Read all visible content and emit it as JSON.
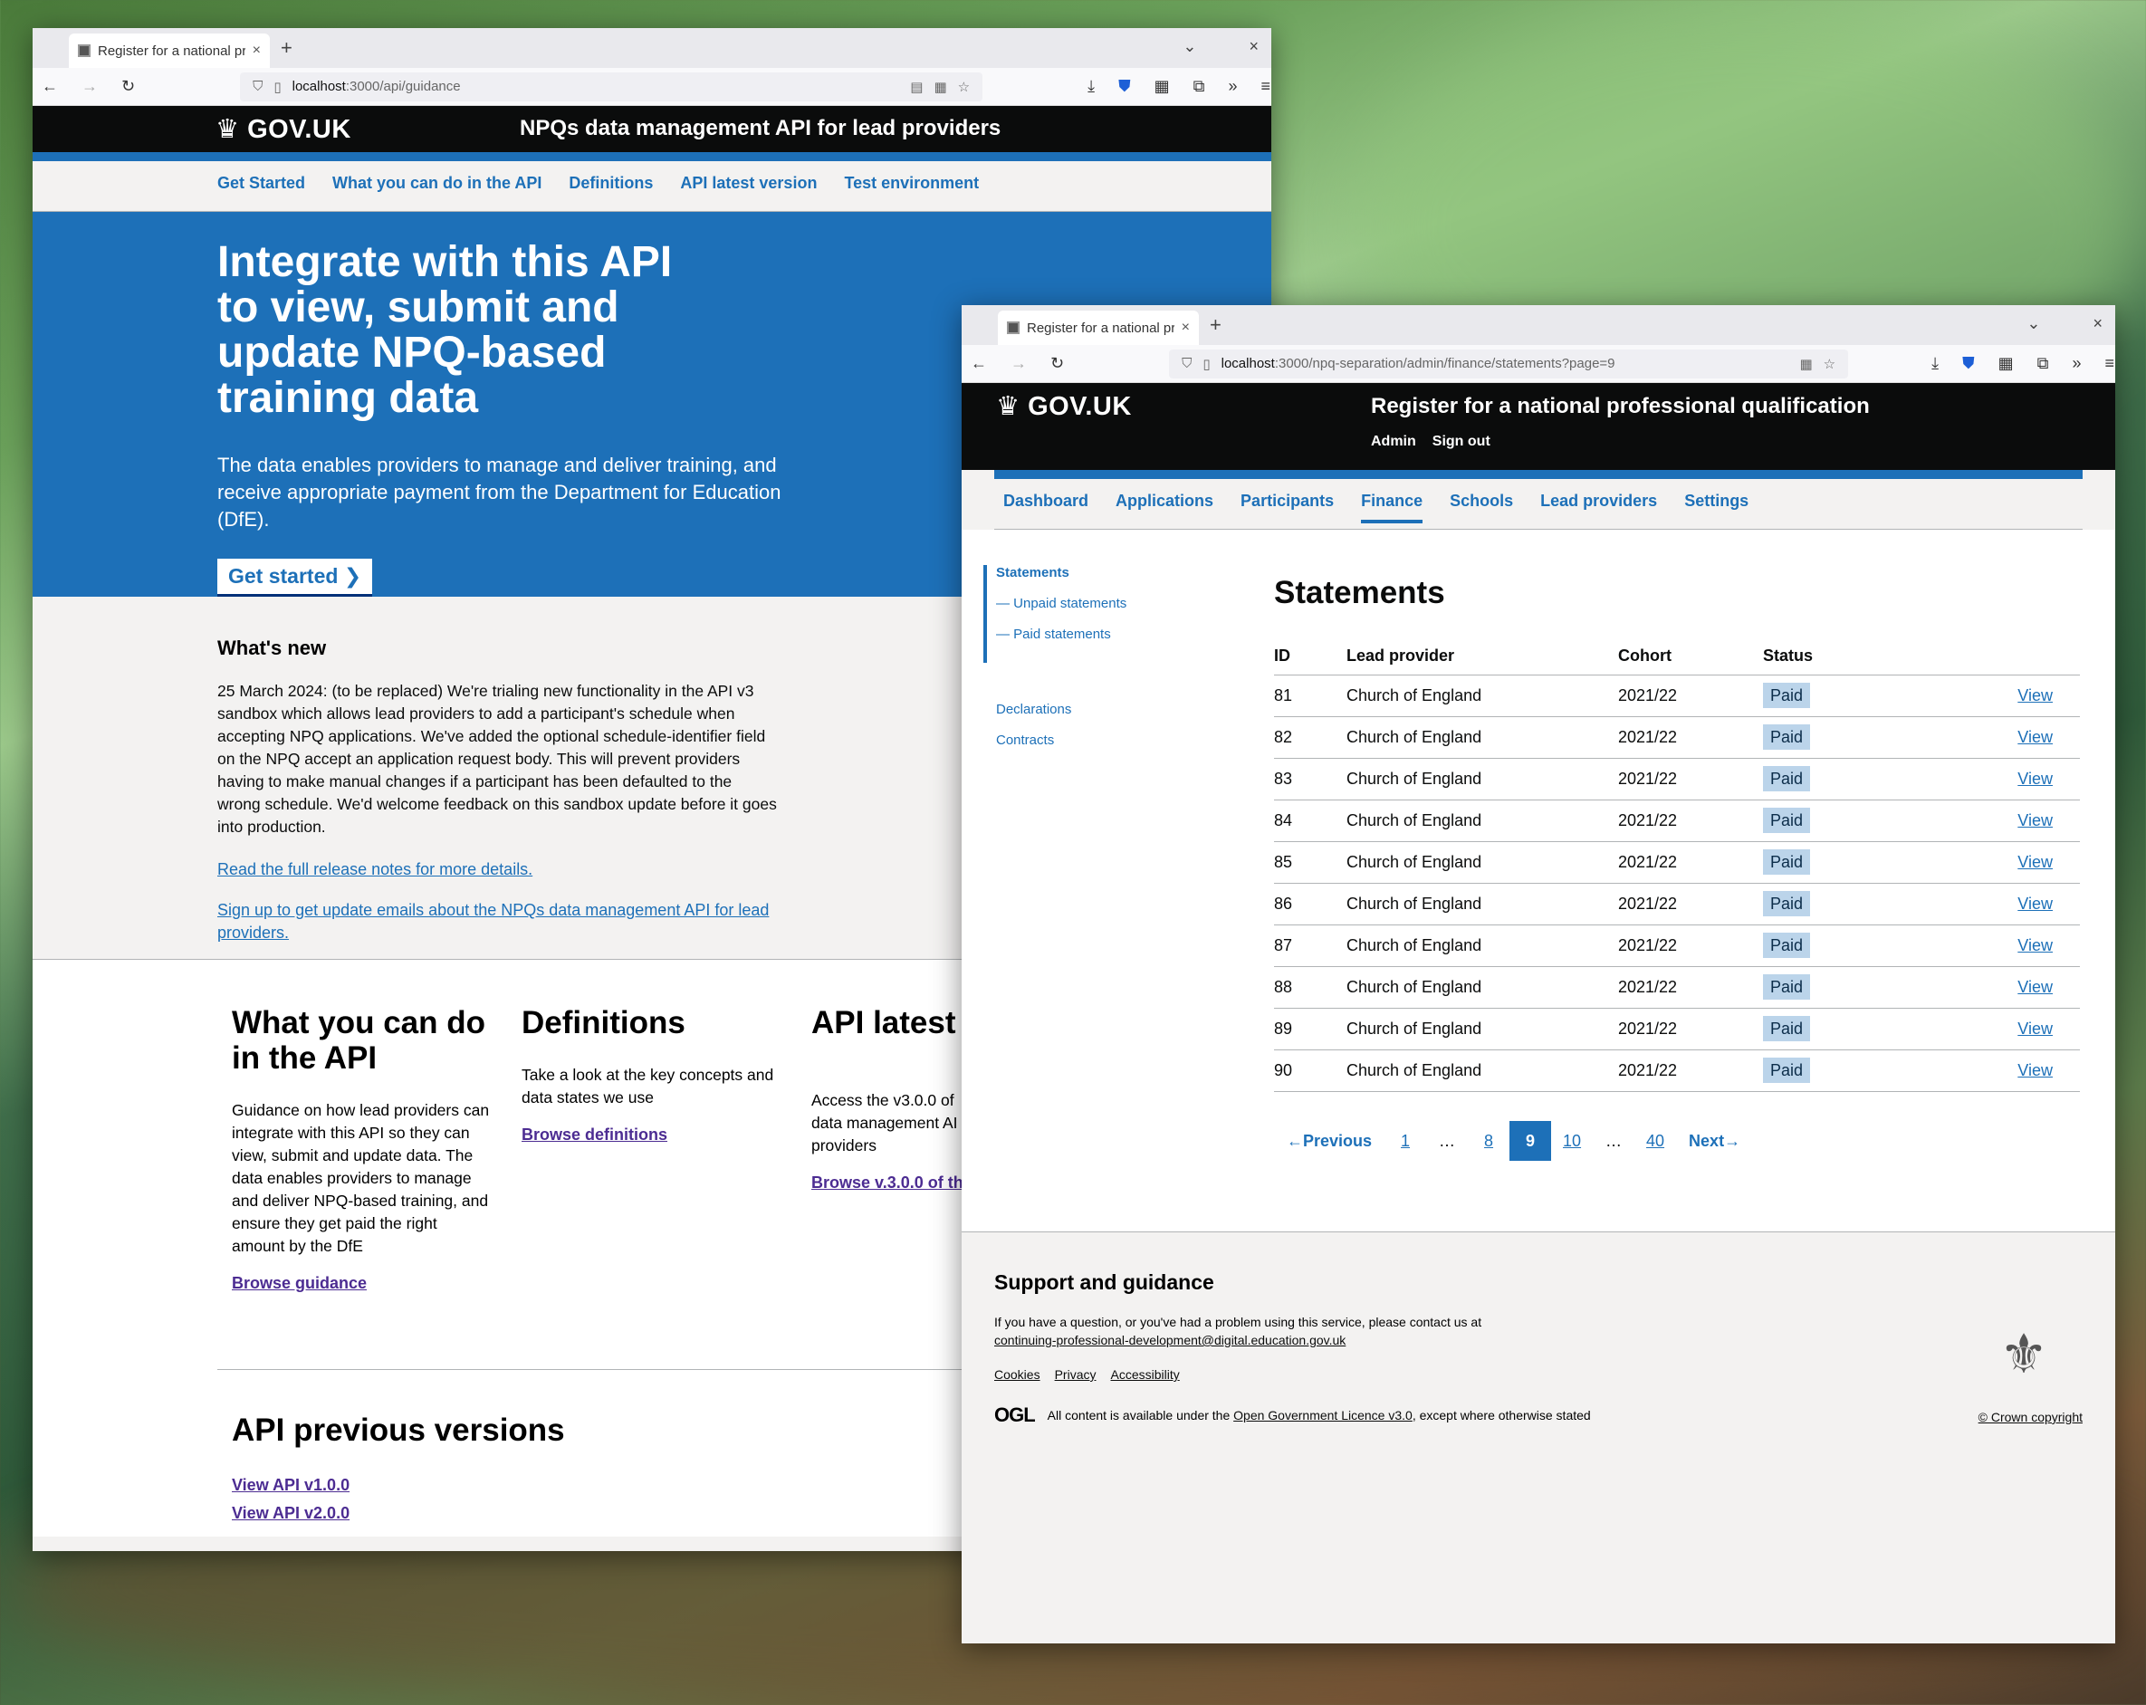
{
  "win1": {
    "tab_title": "Register for a national pr",
    "url_host": "localhost",
    "url_rest": ":3000/api/guidance",
    "brand": "GOV.UK",
    "service": "NPQs data management API for lead providers",
    "nav": [
      "Get Started",
      "What you can do in the API",
      "Definitions",
      "API latest version",
      "Test environment"
    ],
    "hero_title": "Integrate with this API to view, submit and update NPQ-based training data",
    "hero_text": "The data enables providers to manage and deliver training, and receive appropriate payment from the Department for Education (DfE).",
    "hero_button": "Get started",
    "news_title": "What's new",
    "news_text": "25 March 2024: (to be replaced) We're trialing new functionality in the API v3 sandbox which allows lead providers to add a participant's schedule when accepting NPQ applications. We've added the optional schedule-identifier field on the NPQ accept an application request body. This will prevent providers having to make manual changes if a participant has been defaulted to the wrong schedule. We'd welcome feedback on this sandbox update before it goes into production.",
    "news_link1": "Read the full release notes for more details.",
    "news_link2": "Sign up to get update emails about the NPQs data management API for lead providers.",
    "cards": [
      {
        "title": "What you can do in the API",
        "text": "Guidance on how lead providers can integrate with this API so they can view, submit and update data. The data enables providers to manage and deliver NPQ-based training, and ensure they get paid the right amount by the DfE",
        "link": "Browse guidance"
      },
      {
        "title": "Definitions",
        "text": "Take a look at the key concepts and data states we use",
        "link": "Browse definitions"
      },
      {
        "title": "API latest v",
        "text": "Access the v3.0.0 of data management AI providers",
        "link": "Browse v.3.0.0 of th"
      }
    ],
    "prev_title": "API previous versions",
    "prev_links": [
      "View API v1.0.0",
      "View API v2.0.0"
    ]
  },
  "win2": {
    "tab_title": "Register for a national pr",
    "url_host": "localhost",
    "url_rest": ":3000/npq-separation/admin/finance/statements?page=9",
    "brand": "GOV.UK",
    "service": "Register for a national professional qualification",
    "account": [
      "Admin",
      "Sign out"
    ],
    "nav": [
      "Dashboard",
      "Applications",
      "Participants",
      "Finance",
      "Schools",
      "Lead providers",
      "Settings"
    ],
    "active_nav": "Finance",
    "side": [
      "Statements",
      "— Unpaid statements",
      "— Paid statements"
    ],
    "side2": [
      "Declarations",
      "Contracts"
    ],
    "heading": "Statements",
    "columns": [
      "ID",
      "Lead provider",
      "Cohort",
      "Status",
      ""
    ],
    "rows": [
      [
        "81",
        "Church of England",
        "2021/22",
        "Paid",
        "View"
      ],
      [
        "82",
        "Church of England",
        "2021/22",
        "Paid",
        "View"
      ],
      [
        "83",
        "Church of England",
        "2021/22",
        "Paid",
        "View"
      ],
      [
        "84",
        "Church of England",
        "2021/22",
        "Paid",
        "View"
      ],
      [
        "85",
        "Church of England",
        "2021/22",
        "Paid",
        "View"
      ],
      [
        "86",
        "Church of England",
        "2021/22",
        "Paid",
        "View"
      ],
      [
        "87",
        "Church of England",
        "2021/22",
        "Paid",
        "View"
      ],
      [
        "88",
        "Church of England",
        "2021/22",
        "Paid",
        "View"
      ],
      [
        "89",
        "Church of England",
        "2021/22",
        "Paid",
        "View"
      ],
      [
        "90",
        "Church of England",
        "2021/22",
        "Paid",
        "View"
      ]
    ],
    "pager": {
      "prev": "Previous",
      "pages": [
        "1",
        "…",
        "8",
        "9",
        "10",
        "…",
        "40"
      ],
      "current": "9",
      "next": "Next"
    },
    "footer": {
      "title": "Support and guidance",
      "text": "If you have a question, or you've had a problem using this service, please contact us at",
      "email": "continuing-professional-development@digital.education.gov.uk",
      "links": [
        "Cookies",
        "Privacy",
        "Accessibility"
      ],
      "ogl_logo": "OGL",
      "ogl_pre": "All content is available under the",
      "ogl_link": "Open Government Licence v3.0",
      "ogl_post": ", except where otherwise stated",
      "copyright": "© Crown copyright"
    }
  }
}
